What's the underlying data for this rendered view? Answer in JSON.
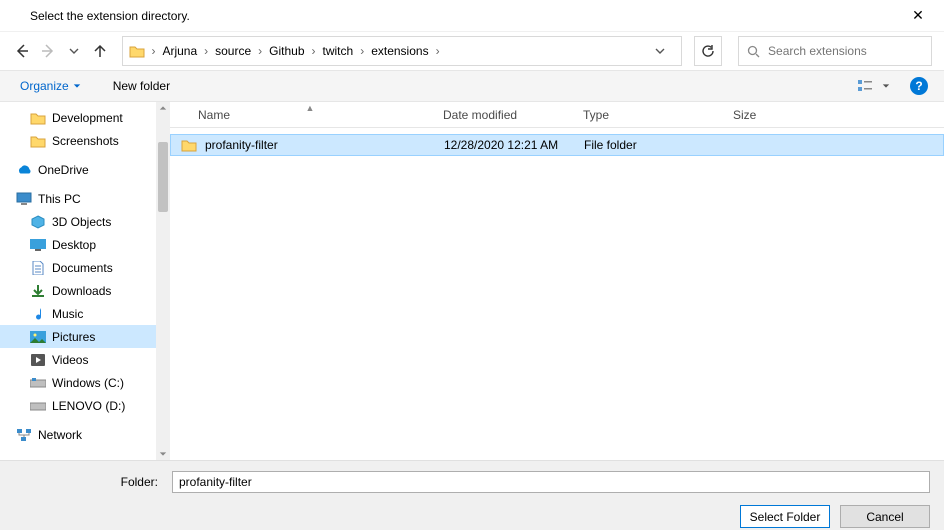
{
  "title": "Select the extension directory.",
  "nav": {
    "crumbs": [
      "Arjuna",
      "source",
      "Github",
      "twitch",
      "extensions"
    ],
    "refresh": "↻"
  },
  "search": {
    "placeholder": "Search extensions"
  },
  "toolbar": {
    "organize": "Organize",
    "newfolder": "New folder"
  },
  "sidebar": {
    "development": "Development",
    "screenshots": "Screenshots",
    "onedrive": "OneDrive",
    "thispc": "This PC",
    "objects3d": "3D Objects",
    "desktop": "Desktop",
    "documents": "Documents",
    "downloads": "Downloads",
    "music": "Music",
    "pictures": "Pictures",
    "videos": "Videos",
    "windowsc": "Windows (C:)",
    "lenovod": "LENOVO (D:)",
    "network": "Network"
  },
  "columns": {
    "name": "Name",
    "date": "Date modified",
    "type": "Type",
    "size": "Size"
  },
  "files": [
    {
      "name": "profanity-filter",
      "date": "12/28/2020 12:21 AM",
      "type": "File folder",
      "size": ""
    }
  ],
  "footer": {
    "folder_label": "Folder:",
    "folder_value": "profanity-filter",
    "select": "Select Folder",
    "cancel": "Cancel"
  }
}
